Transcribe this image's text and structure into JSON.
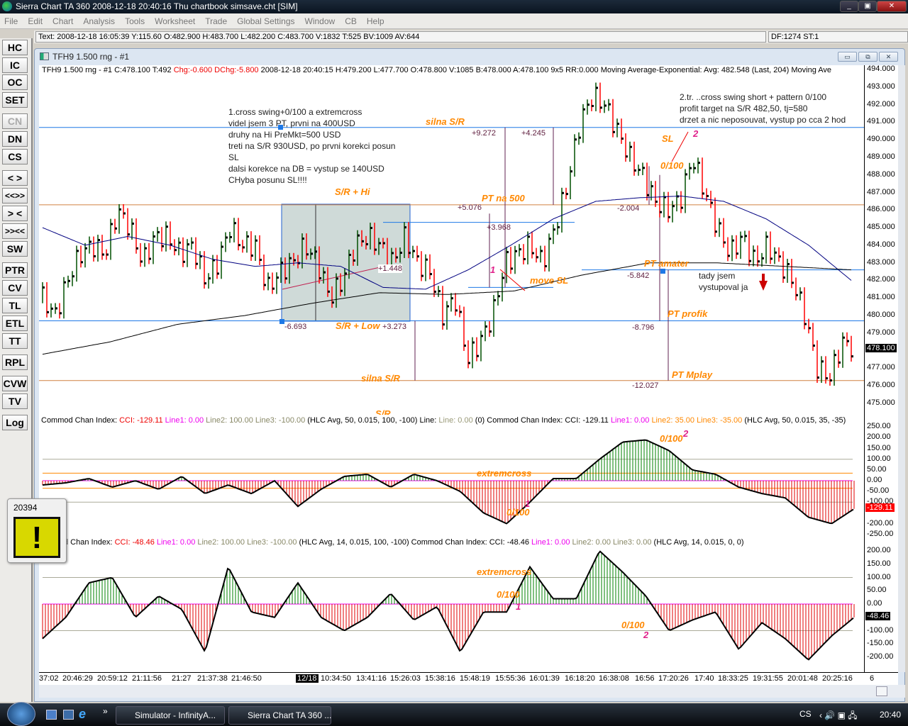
{
  "window": {
    "title": "Sierra Chart TA 360  2008-12-18  20:40:16  Thu   chartbook simsave.cht [SIM]"
  },
  "menu": [
    "File",
    "Edit",
    "Chart",
    "Analysis",
    "Tools",
    "Worksheet",
    "Trade",
    "Global Settings",
    "Window",
    "CB",
    "Help"
  ],
  "info_text": "Text: 2008-12-18  16:05:39  Y:115.60  O:482.900  H:483.700  L:482.200  C:483.700  V:1832  T:525  BV:1009  AV:644",
  "df_text": "DF:1274  ST:1",
  "toolbar": [
    "HC",
    "IC",
    "OC",
    "SET",
    "CN",
    "DN",
    "CS",
    "< >",
    "<<>>",
    "> <",
    ">><<",
    "SW",
    "PTR",
    "CV",
    "TL",
    "ETL",
    "TT",
    "RPL",
    "CVW",
    "TV",
    "Log"
  ],
  "chart_window": {
    "title": "TFH9  1.500 rng - #1"
  },
  "price_header": {
    "sym": "TFH9  1.500 rng - #1  C:478.100  T:492 ",
    "chg": "Chg:-0.600  DChg:-5.800",
    "rest": " 2008-12-18  20:40:15  H:479.200  L:477.700  O:478.800  V:1085  B:478.000  A:478.100  9x5  RR:0.000  Moving Average-Exponential:  Avg: 482.548   (Last, 204)   Moving Ave"
  },
  "cci1_header": {
    "a": "Commod Chan Index:  ",
    "cci": "CCI: -129.11  ",
    "l1": "Line1: 0.00  ",
    "l2": "Line2: 100.00  ",
    "l3": "Line3: -100.00  ",
    "p": " (HLC Avg, 50, 0.015, 100, -100)   Line:  ",
    "line": "Line: 0.00",
    "b": "   (0)   Commod Chan Index:  CCI: -129.11  ",
    "l1b": "Line1: 0.00  ",
    "l2b": "Line2: 35.00  ",
    "l3b": "Line3: -35.00  ",
    "pb": "  (HLC Avg, 50, 0.015, 35, -35)"
  },
  "cci2_header": {
    "a": "d Chan Index:  ",
    "cci": "CCI: -48.46  ",
    "l1": "Line1: 0.00  ",
    "l2": "Line2: 100.00  ",
    "l3": "Line3: -100.00  ",
    "p": "  (HLC Avg, 14, 0.015, 100, -100)   Commod Chan Index:  CCI: -48.46  ",
    "l1b": "Line1: 0.00  ",
    "l2b": "Line2: 0.00  ",
    "l3b": "Line3: 0.00  ",
    "pb": "  (HLC Avg, 14, 0.015, 0, 0)"
  },
  "notes": {
    "n1": [
      "1.cross swing+0/100 a extremcross",
      "videl jsem 3 PT, prvni na 400USD",
      "druhy na Hi PreMkt=500 USD",
      "treti na S/R 930USD, po prvni korekci posun",
      "SL",
      "dalsi korekce na DB = vystup se 140USD",
      "CHyba posunu SL!!!!"
    ],
    "n2": [
      "2.tr. ..cross swing short + pattern 0/100",
      "profit target na S/R 482,50, tj=580",
      "drzet a nic neposouvat, vystup po cca 2 hod"
    ],
    "n3": [
      "tady jsem",
      "vystupoval ja"
    ]
  },
  "labels": {
    "silna_sr": "silna S/R",
    "sr_hi": "S/R + Hi",
    "sr_low": "S/R + Low",
    "silna_sr2": "silna S/R",
    "sr_cut": "S/R",
    "pt500": "PT na 500",
    "move_sl": "move SL",
    "sl": "SL",
    "zero100": "0/100",
    "pt_amater": "PT amater",
    "pt_profik": "PT profik",
    "pt_mplay": "PT Mplay",
    "extremcross": "extremcross",
    "extremcross2": "extremcross",
    "c1_0100": "0/100",
    "c1_0100b": "0/100",
    "c2_0100": "0/100",
    "c2_0100b": "0/100",
    "one": "1",
    "two": "2",
    "c1_one": "1",
    "c1_two": "2",
    "c2_one": "1",
    "c2_two": "2"
  },
  "measures": [
    "+9.272",
    "+4.245",
    "+5.076",
    "+3.968",
    "+1.448",
    "-6.693",
    "+3.273",
    "-2.004",
    "-5.842",
    "-8.796",
    "-12.027"
  ],
  "price_axis": [
    "494.000",
    "493.000",
    "492.000",
    "491.000",
    "490.000",
    "489.000",
    "488.000",
    "487.000",
    "486.000",
    "485.000",
    "484.000",
    "483.000",
    "482.000",
    "481.000",
    "480.000",
    "479.000",
    "477.000",
    "476.000",
    "475.000"
  ],
  "last_price": "478.100",
  "cci1_axis": [
    "250.00",
    "200.00",
    "150.00",
    "100.00",
    "50.00",
    "0.00",
    "-50.00",
    "-100.00",
    "-200.00",
    "-250.00"
  ],
  "cci1_last": "-129.11",
  "cci2_axis": [
    "200.00",
    "150.00",
    "100.00",
    "50.00",
    "0.00",
    "-100.00",
    "-150.00",
    "-200.00"
  ],
  "cci2_last": "-48.46",
  "time_axis": [
    "37:02",
    "20:46:29",
    "20:59:12",
    "21:11:56",
    "21:27",
    "21:37:38",
    "21:46:50",
    "12/18",
    "10:34:50",
    "13:41:16",
    "15:26:03",
    "15:38:16",
    "15:48:19",
    "15:55:36",
    "16:01:39",
    "16:18:20",
    "16:38:08",
    "16:56",
    "17:20:26",
    "17:40",
    "18:33:25",
    "19:31:55",
    "20:01:48",
    "20:25:16",
    "6"
  ],
  "alert": {
    "count": "20394"
  },
  "taskbar": {
    "items": [
      "Simulator - InfinityA...",
      "Sierra Chart TA 360  ..."
    ],
    "lang": "CS",
    "clock": "20:40"
  },
  "colors": {
    "up": "#005000",
    "down": "#ff0000",
    "ema_fast": "#000080",
    "ema_slow": "#000000",
    "sr_blue": "#1e78e6",
    "sr_orange": "#d08040"
  },
  "chart_data": {
    "type": "line",
    "price_close_waypoints": [
      481,
      480,
      482,
      483.5,
      484,
      483.5,
      486,
      485,
      483,
      484.5,
      484.5,
      483.5,
      484,
      482,
      483,
      485,
      484,
      484,
      481.5,
      482.5,
      483,
      484,
      483,
      481,
      482,
      484,
      484.5,
      484,
      483,
      484.5,
      483,
      482.5,
      480,
      481,
      477.5,
      478.5,
      480,
      483,
      483.5,
      484,
      483,
      485,
      487.5,
      491,
      492.5,
      492,
      490.5,
      489,
      488,
      486.5,
      486,
      486.5,
      489,
      487,
      485,
      483.5,
      484.5,
      483,
      484,
      483,
      482,
      480,
      477,
      476.5,
      478.5,
      478.1
    ],
    "ema_fast": [
      485,
      484,
      484.5,
      484,
      483.2,
      482.8,
      483,
      482.8,
      481.6,
      481.5,
      482.6,
      484,
      485.5,
      486.5,
      486.7,
      486.8,
      486.5,
      485.5,
      484,
      482
    ],
    "ema_slow": [
      477.8,
      478.5,
      479.5,
      480,
      480.7,
      481.3,
      481.2,
      481.4,
      482.3,
      483,
      483,
      482.8,
      482.6
    ],
    "cci50": [
      -20,
      -10,
      10,
      -30,
      0,
      -40,
      20,
      -60,
      -20,
      -60,
      0,
      -120,
      -40,
      20,
      30,
      -30,
      30,
      0,
      -50,
      -150,
      -200,
      -100,
      10,
      10,
      100,
      180,
      190,
      140,
      50,
      30,
      -30,
      -60,
      -80,
      -170,
      -200,
      -129
    ],
    "cci14": [
      -130,
      -50,
      80,
      100,
      -50,
      30,
      -20,
      -180,
      140,
      -30,
      -50,
      80,
      -50,
      -100,
      -50,
      40,
      -60,
      -10,
      -180,
      -30,
      -30,
      140,
      20,
      20,
      200,
      120,
      30,
      -100,
      -60,
      -30,
      -170,
      -70,
      -130,
      -210,
      -120,
      -48
    ],
    "ylim_price": [
      475,
      494
    ]
  }
}
